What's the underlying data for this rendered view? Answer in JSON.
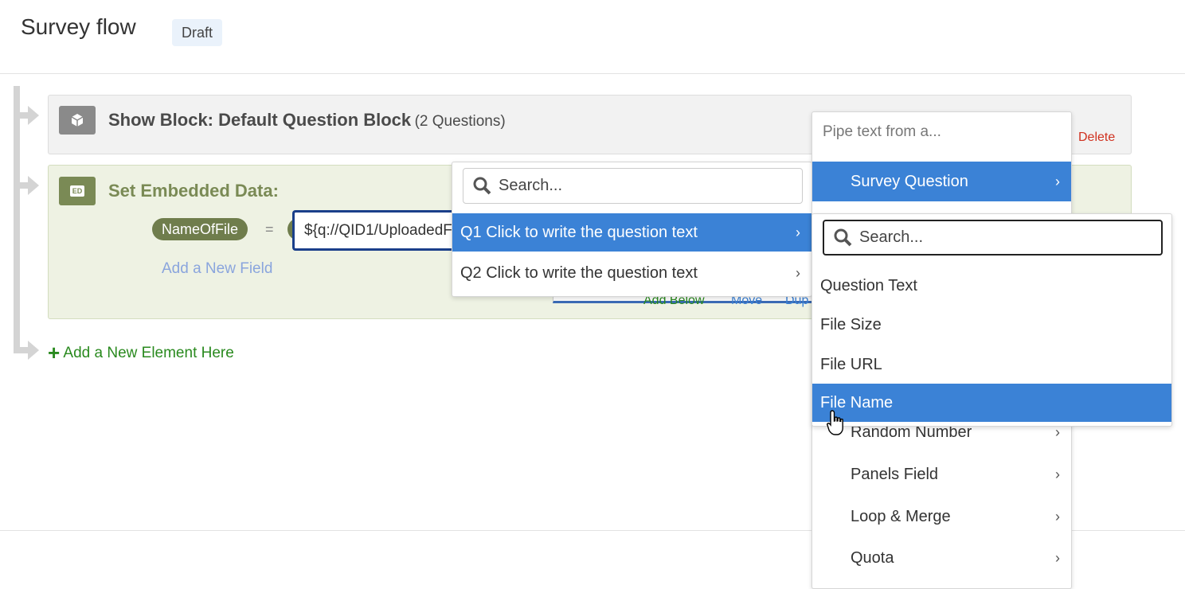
{
  "header": {
    "title": "Survey flow",
    "status_badge": "Draft"
  },
  "flow": {
    "show_block": {
      "label": "Show Block: Default Question Block",
      "count": "(2 Questions)",
      "delete_label": "Delete",
      "icon": "cube-icon"
    },
    "embedded": {
      "label": "Set Embedded Data:",
      "icon_text": "ED",
      "field_name": "NameOfFile",
      "equals": "=",
      "field_value": "${q://QID1/UploadedF",
      "add_field": "Add a New Field",
      "actions": [
        "Add Below",
        "Move",
        "Dup"
      ]
    },
    "add_element": "Add a New Element Here"
  },
  "question_menu": {
    "search_placeholder": "Search...",
    "items": [
      {
        "label": "Q1 Click to write the question text",
        "selected": true
      },
      {
        "label": "Q2 Click to write the question text",
        "selected": false
      }
    ]
  },
  "pipe_menu": {
    "title": "Pipe text from a...",
    "items": [
      {
        "label": "Survey Question",
        "selected": true
      },
      {
        "label": "Random Number"
      },
      {
        "label": "Panels Field"
      },
      {
        "label": "Loop & Merge"
      },
      {
        "label": "Quota"
      }
    ]
  },
  "field_menu": {
    "search_placeholder": "Search...",
    "items": [
      {
        "label": "Question Text"
      },
      {
        "label": "File Size"
      },
      {
        "label": "File URL"
      },
      {
        "label": "File Name",
        "selected": true
      }
    ]
  },
  "colors": {
    "accent": "#3b82d6",
    "embedded_green": "#6f7d4c",
    "delete_red": "#d0311f",
    "add_green": "#2a8a1f"
  }
}
